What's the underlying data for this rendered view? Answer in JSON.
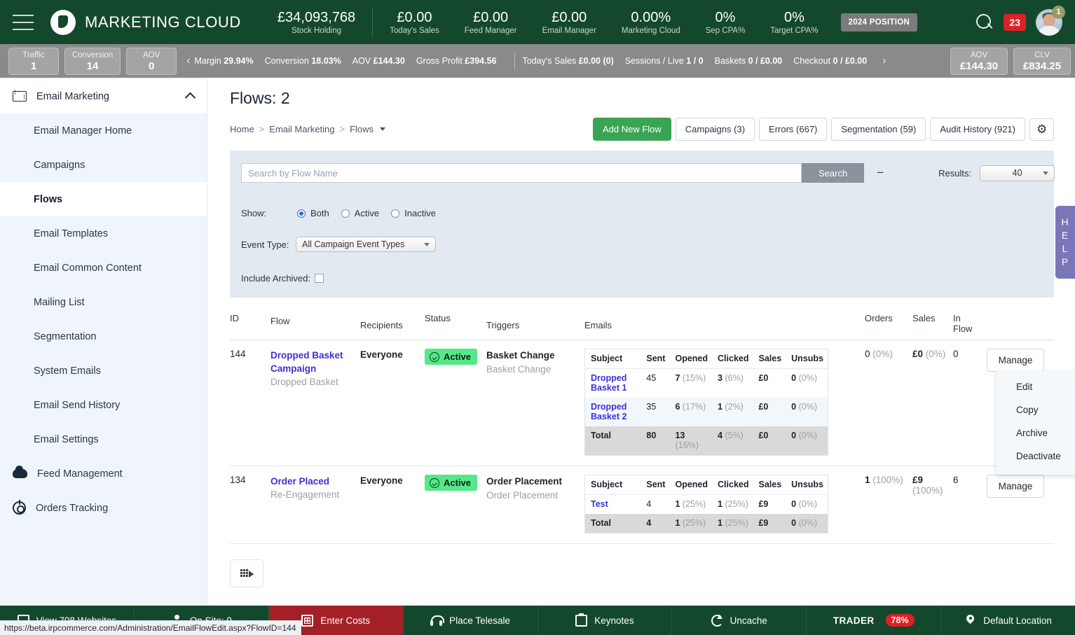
{
  "header": {
    "brand": "MARKETING CLOUD",
    "stats": [
      {
        "value": "£34,093,768",
        "label": "Stock Holding"
      },
      {
        "value": "£0.00",
        "label": "Today's Sales"
      },
      {
        "value": "£0.00",
        "label": "Feed Manager"
      },
      {
        "value": "£0.00",
        "label": "Email Manager"
      },
      {
        "value": "0.00%",
        "label": "Marketing Cloud"
      },
      {
        "value": "0%",
        "label": "Sep CPA%"
      },
      {
        "value": "0%",
        "label": "Target CPA%"
      }
    ],
    "position_badge": "2024 POSITION",
    "notification_count": "23",
    "avatar_badge": "1",
    "search_icon": "search-icon"
  },
  "subbar": {
    "kpis": [
      {
        "label": "Traffic",
        "value": "1"
      },
      {
        "label": "Conversion",
        "value": "14"
      },
      {
        "label": "AOV",
        "value": "0"
      }
    ],
    "arrow_left": "‹",
    "arrow_right": "›",
    "metrics_left": [
      {
        "label": "Margin",
        "value": "29.94%"
      },
      {
        "label": "Conversion",
        "value": "18.03%"
      },
      {
        "label": "AOV",
        "value": "£144.30"
      },
      {
        "label": "Gross Profit",
        "value": "£394.56"
      }
    ],
    "metrics_right": [
      {
        "label": "Today's Sales",
        "value": "£0.00 (0)"
      },
      {
        "label": "Sessions / Live",
        "value": "1 / 0"
      },
      {
        "label": "Baskets",
        "value": "0 / £0.00"
      },
      {
        "label": "Checkout",
        "value": "0 / £0.00"
      }
    ],
    "right_kpis": [
      {
        "label": "AOV",
        "value": "£144.30"
      },
      {
        "label": "CLV",
        "value": "£834.25"
      }
    ]
  },
  "sidebar": {
    "group_label": "Email Marketing",
    "items": [
      {
        "label": "Email Manager Home",
        "active": false
      },
      {
        "label": "Campaigns",
        "active": false
      },
      {
        "label": "Flows",
        "active": true
      },
      {
        "label": "Email Templates",
        "active": false
      },
      {
        "label": "Email Common Content",
        "active": false
      },
      {
        "label": "Mailing List",
        "active": false
      },
      {
        "label": "Segmentation",
        "active": false
      },
      {
        "label": "System Emails",
        "active": false
      },
      {
        "label": "Email Send History",
        "active": false
      },
      {
        "label": "Email Settings",
        "active": false
      }
    ],
    "bottom_items": [
      {
        "label": "Feed Management",
        "icon": "cloud-icon"
      },
      {
        "label": "Orders Tracking",
        "icon": "tracking-icon"
      }
    ]
  },
  "page": {
    "title": "Flows: 2",
    "breadcrumbs": [
      "Home",
      "Email Marketing",
      "Flows"
    ],
    "buttons": {
      "add_new_flow": "Add New Flow",
      "campaigns": "Campaigns (3)",
      "errors": "Errors (667)",
      "segmentation": "Segmentation (59)",
      "audit_history": "Audit History (921)",
      "settings_icon": "gear-icon"
    }
  },
  "filters": {
    "search_placeholder": "Search by Flow Name",
    "search_value": "",
    "search_button": "Search",
    "collapse_icon": "minus-icon",
    "results_label": "Results:",
    "results_value": "40",
    "show_label": "Show:",
    "show_options": [
      "Both",
      "Active",
      "Inactive"
    ],
    "show_selected": "Both",
    "event_type_label": "Event Type:",
    "event_type_value": "All Campaign Event Types",
    "include_archived_label": "Include Archived:",
    "include_archived_checked": false
  },
  "table": {
    "columns": [
      "ID",
      "Flow",
      "Recipients",
      "Status",
      "Triggers",
      "Emails",
      "Orders",
      "Sales",
      "In Flow"
    ],
    "in_flow_line1": "In",
    "in_flow_line2": "Flow",
    "email_columns": [
      "Subject",
      "Sent",
      "Opened",
      "Clicked",
      "Sales",
      "Unsubs"
    ],
    "manage_label": "Manage",
    "rows": [
      {
        "id": "144",
        "flow_name": "Dropped Basket Campaign",
        "flow_sub": "Dropped Basket",
        "recipients": "Everyone",
        "status": "Active",
        "trigger_main": "Basket Change",
        "trigger_sub": "Basket Change",
        "emails": [
          {
            "subject": "Dropped Basket 1",
            "sent": "45",
            "opened": "7",
            "opened_pct": "(15%)",
            "clicked": "3",
            "clicked_pct": "(6%)",
            "sales": "£0",
            "unsubs": "0",
            "unsubs_pct": "(0%)"
          },
          {
            "subject": "Dropped Basket 2",
            "sent": "35",
            "opened": "6",
            "opened_pct": "(17%)",
            "clicked": "1",
            "clicked_pct": "(2%)",
            "sales": "£0",
            "unsubs": "0",
            "unsubs_pct": "(0%)"
          }
        ],
        "total": {
          "subject": "Total",
          "sent": "80",
          "opened": "13",
          "opened_pct": "(16%)",
          "clicked": "4",
          "clicked_pct": "(5%)",
          "sales": "£0",
          "unsubs": "0",
          "unsubs_pct": "(0%)"
        },
        "orders": "0",
        "orders_pct": "(0%)",
        "sales": "£0",
        "sales_pct": "(0%)",
        "in_flow": "0"
      },
      {
        "id": "134",
        "flow_name": "Order Placed",
        "flow_sub": "Re-Engagement",
        "recipients": "Everyone",
        "status": "Active",
        "trigger_main": "Order Placement",
        "trigger_sub": "Order Placement",
        "emails": [
          {
            "subject": "Test",
            "sent": "4",
            "opened": "1",
            "opened_pct": "(25%)",
            "clicked": "1",
            "clicked_pct": "(25%)",
            "sales": "£9",
            "unsubs": "0",
            "unsubs_pct": "(0%)"
          }
        ],
        "total": {
          "subject": "Total",
          "sent": "4",
          "opened": "1",
          "opened_pct": "(25%)",
          "clicked": "1",
          "clicked_pct": "(25%)",
          "sales": "£9",
          "unsubs": "0",
          "unsubs_pct": "(0%)"
        },
        "orders": "1",
        "orders_pct": "(100%)",
        "sales": "£9",
        "sales_pct": "(100%)",
        "in_flow": "6"
      }
    ]
  },
  "manage_menu": {
    "items": [
      "Edit",
      "Copy",
      "Archive",
      "Deactivate"
    ]
  },
  "export": {
    "icon": "export-grid-icon"
  },
  "help_tab": {
    "letters": [
      "H",
      "E",
      "L",
      "P"
    ]
  },
  "footer": {
    "items": [
      {
        "label": "View 708 Websites",
        "icon": "window-icon"
      },
      {
        "label": "On Site:  0",
        "icon": "person-icon"
      },
      {
        "label": "Enter Costs",
        "icon": "calculator-icon",
        "highlight": true
      },
      {
        "label": "Place Telesale",
        "icon": "headset-icon"
      },
      {
        "label": "Keynotes",
        "icon": "clipboard-icon"
      },
      {
        "label": "Uncache",
        "icon": "refresh-icon"
      },
      {
        "label": "TRADER",
        "icon": "",
        "badge": "78%"
      },
      {
        "label": "Default Location",
        "icon": "pin-icon"
      }
    ]
  },
  "status_url": "https://beta.irpcommerce.com/Administration/EmailFlowEdit.aspx?FlowID=144",
  "colors": {
    "header_green": "#14482c",
    "accent_green": "#3aa455",
    "status_green": "#55e888",
    "badge_red": "#e01f26",
    "link_blue": "#3b31d6",
    "help_purple": "#7a76b8"
  }
}
